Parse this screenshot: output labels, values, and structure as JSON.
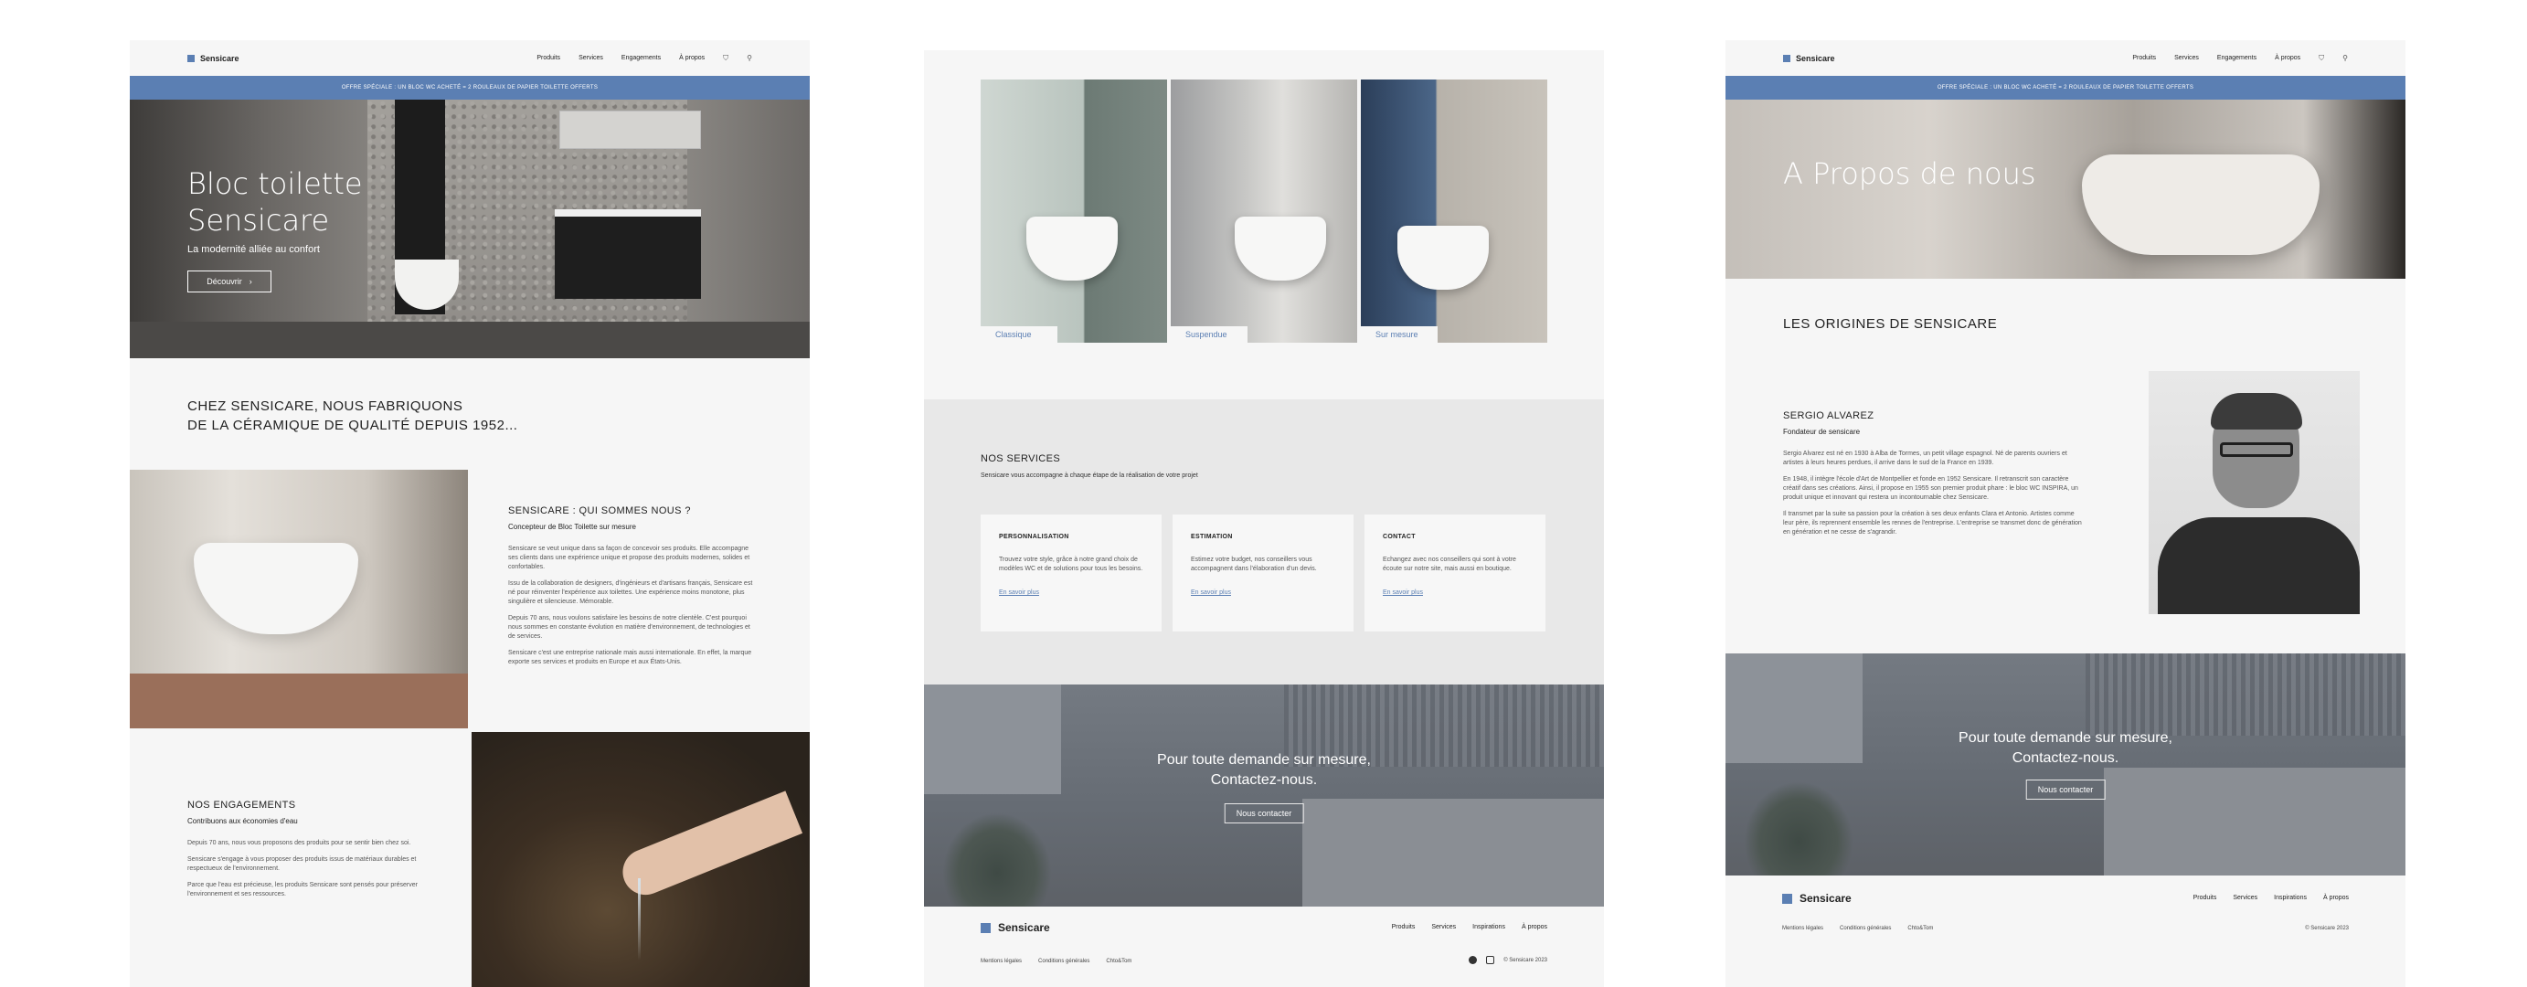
{
  "brand": {
    "name": "Sensicare",
    "accent": "#5b7fb3"
  },
  "nav": {
    "items": [
      "Produits",
      "Services",
      "Engagements",
      "À propos"
    ],
    "cart_icon": "cart-icon",
    "user_icon": "user-icon"
  },
  "promo": "OFFRE SPÉCIALE : UN BLOC WC ACHETÉ = 2 ROULEAUX DE PAPIER TOILETTE OFFERTS",
  "home": {
    "hero_title_1": "Bloc toilette",
    "hero_title_2": "Sensicare",
    "hero_subtitle": "La modernité alliée au confort",
    "hero_button": "Découvrir",
    "tagline_1": "CHEZ SENSICARE, NOUS FABRIQUONS",
    "tagline_2": "DE LA CÉRAMIQUE DE QUALITÉ DEPUIS 1952...",
    "about": {
      "title": "SENSICARE : QUI SOMMES NOUS ?",
      "subtitle": "Concepteur de Bloc Toilette sur mesure",
      "p1": "Sensicare se veut unique dans sa façon de concevoir ses produits. Elle accompagne ses clients dans une expérience unique et propose des produits modernes, solides et confortables.",
      "p2": "Issu de la collaboration de designers, d'ingénieurs et d'artisans français, Sensicare est né pour réinventer l'expérience aux toilettes. Une expérience moins monotone, plus singulière et silencieuse. Mémorable.",
      "p3": "Depuis 70 ans, nous voulons satisfaire les besoins de notre clientèle. C'est pourquoi nous sommes en constante évolution en matière d'environnement, de technologies et de services.",
      "p4": "Sensicare c'est une entreprise nationale mais aussi internationale. En effet, la marque exporte ses services et produits en Europe et aux États-Unis."
    },
    "engagements": {
      "title": "NOS ENGAGEMENTS",
      "subtitle": "Contribuons aux économies d'eau",
      "p1": "Depuis 70 ans, nous vous proposons des produits pour se sentir bien chez soi.",
      "p2": "Sensicare s'engage à vous proposer des produits issus de matériaux durables et respectueux de l'environnement.",
      "p3": "Parce que l'eau est précieuse, les produits Sensicare sont pensés pour préserver l'environnement et ses ressources."
    }
  },
  "products": {
    "gallery": [
      "Classique",
      "Suspendue",
      "Sur mesure"
    ],
    "services_title": "NOS SERVICES",
    "services_subtitle": "Sensicare vous accompagne à chaque étape de la réalisation de votre projet",
    "cards": [
      {
        "title": "PERSONNALISATION",
        "text": "Trouvez votre style, grâce à notre grand choix de modèles WC et de solutions pour tous les besoins.",
        "link": "En savoir plus"
      },
      {
        "title": "ESTIMATION",
        "text": "Estimez votre budget, nos conseillers vous accompagnent dans l'élaboration d'un devis.",
        "link": "En savoir plus"
      },
      {
        "title": "CONTACT",
        "text": "Echangez avec nos conseillers qui sont à votre écoute sur notre site, mais aussi en boutique.",
        "link": "En savoir plus"
      }
    ]
  },
  "cta": {
    "line1": "Pour toute demande sur mesure,",
    "line2": "Contactez-nous.",
    "button": "Nous contacter"
  },
  "footer": {
    "menu": [
      "Produits",
      "Services",
      "Inspirations",
      "À propos"
    ],
    "links": [
      "Mentions légales",
      "Conditions générales",
      "Chto&Tom"
    ],
    "copyright": "© Sensicare 2023",
    "social": [
      "pinterest-icon",
      "instagram-icon"
    ]
  },
  "about_page": {
    "hero_title": "A Propos de nous",
    "origins_title": "LES ORIGINES DE SENSICARE",
    "founder_name": "SERGIO ALVAREZ",
    "founder_role": "Fondateur de sensicare",
    "p1": "Sergio Alvarez est né en 1930 à Alba de Tormes, un petit village espagnol. Né de parents ouvriers et artistes à leurs heures perdues, il arrive dans le sud de la France en 1939.",
    "p2": "En 1948, il intègre l'école d'Art de Montpellier et fonde en 1952 Sensicare. Il retranscrit son caractère créatif dans ses créations. Ainsi, il propose en 1955 son premier produit phare : le bloc WC INSPIRA, un produit unique et innovant qui restera un incontournable chez Sensicare.",
    "p3": "Il transmet par la suite sa passion pour la création à ses deux enfants Clara et Antonio. Artistes comme leur père, ils reprennent ensemble les rennes de l'entreprise. L'entreprise se transmet donc de génération en génération et ne cesse de s'agrandir."
  }
}
